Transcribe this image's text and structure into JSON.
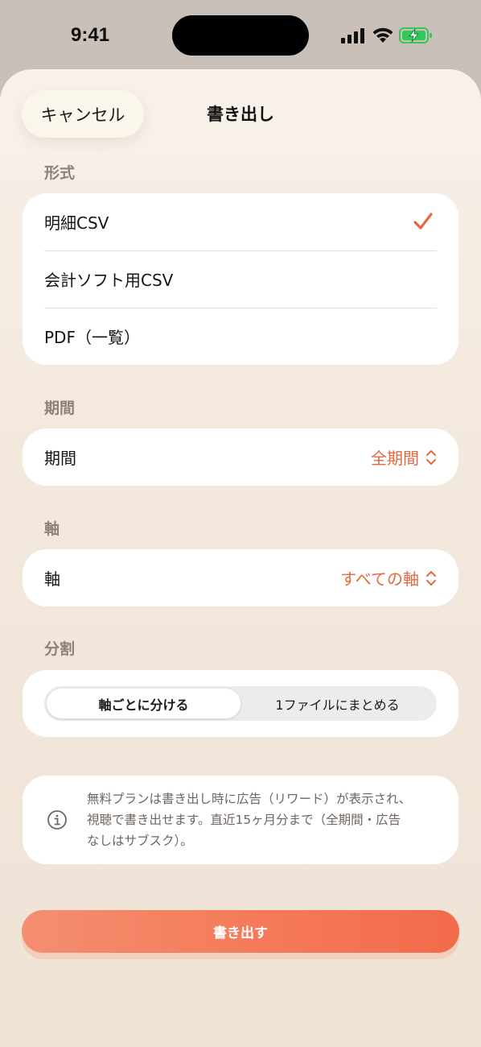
{
  "status_bar": {
    "time": "9:41",
    "icons": [
      "cellular-signal-icon",
      "wifi-icon",
      "battery-charging-icon"
    ],
    "battery_color": "#34c759"
  },
  "nav": {
    "cancel_label": "キャンセル",
    "title": "書き出し"
  },
  "format": {
    "section_label": "形式",
    "options": [
      {
        "label": "明細CSV",
        "selected": true
      },
      {
        "label": "会計ソフト用CSV",
        "selected": false
      },
      {
        "label": "PDF（一覧）",
        "selected": false
      }
    ]
  },
  "period": {
    "section_label": "期間",
    "row_label": "期間",
    "value": "全期間"
  },
  "axis": {
    "section_label": "軸",
    "row_label": "軸",
    "value": "すべての軸"
  },
  "split": {
    "section_label": "分割",
    "segments": [
      {
        "label": "軸ごとに分ける",
        "selected": true
      },
      {
        "label": "1ファイルにまとめる",
        "selected": false
      }
    ]
  },
  "info": {
    "icon": "info-circle-icon",
    "lines": [
      "無料プランは書き出し時に広告（リワード）が表示され、",
      "視聴で書き出せます。直近15ヶ月分まで（全期間・広告",
      "なしはサブスク）。"
    ]
  },
  "export_button_label": "書き出す",
  "colors": {
    "accent": "#e5683f",
    "button_start": "#f48e70",
    "button_end": "#f26b4b"
  }
}
